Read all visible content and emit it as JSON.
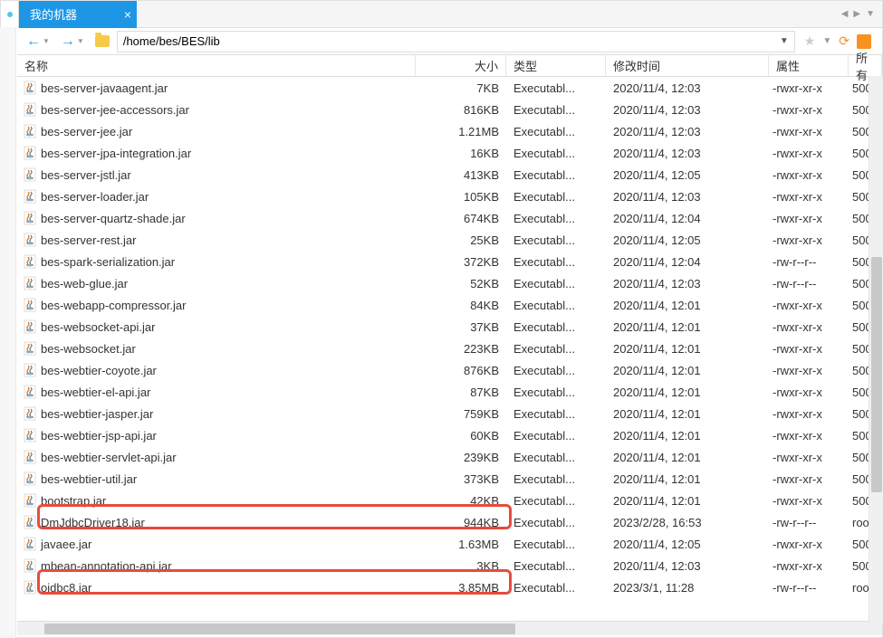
{
  "tab": {
    "title": "我的机器"
  },
  "path": "/home/bes/BES/lib",
  "headers": {
    "name": "名称",
    "size": "大小",
    "type": "类型",
    "date": "修改时间",
    "attr": "属性",
    "owner": "所有"
  },
  "type_label": "Executabl...",
  "files": [
    {
      "name": "bes-server-javaagent.jar",
      "size": "7KB",
      "date": "2020/11/4, 12:03",
      "attr": "-rwxr-xr-x",
      "owner": "500"
    },
    {
      "name": "bes-server-jee-accessors.jar",
      "size": "816KB",
      "date": "2020/11/4, 12:03",
      "attr": "-rwxr-xr-x",
      "owner": "500"
    },
    {
      "name": "bes-server-jee.jar",
      "size": "1.21MB",
      "date": "2020/11/4, 12:03",
      "attr": "-rwxr-xr-x",
      "owner": "500"
    },
    {
      "name": "bes-server-jpa-integration.jar",
      "size": "16KB",
      "date": "2020/11/4, 12:03",
      "attr": "-rwxr-xr-x",
      "owner": "500"
    },
    {
      "name": "bes-server-jstl.jar",
      "size": "413KB",
      "date": "2020/11/4, 12:05",
      "attr": "-rwxr-xr-x",
      "owner": "500"
    },
    {
      "name": "bes-server-loader.jar",
      "size": "105KB",
      "date": "2020/11/4, 12:03",
      "attr": "-rwxr-xr-x",
      "owner": "500"
    },
    {
      "name": "bes-server-quartz-shade.jar",
      "size": "674KB",
      "date": "2020/11/4, 12:04",
      "attr": "-rwxr-xr-x",
      "owner": "500"
    },
    {
      "name": "bes-server-rest.jar",
      "size": "25KB",
      "date": "2020/11/4, 12:05",
      "attr": "-rwxr-xr-x",
      "owner": "500"
    },
    {
      "name": "bes-spark-serialization.jar",
      "size": "372KB",
      "date": "2020/11/4, 12:04",
      "attr": "-rw-r--r--",
      "owner": "500"
    },
    {
      "name": "bes-web-glue.jar",
      "size": "52KB",
      "date": "2020/11/4, 12:03",
      "attr": "-rw-r--r--",
      "owner": "500"
    },
    {
      "name": "bes-webapp-compressor.jar",
      "size": "84KB",
      "date": "2020/11/4, 12:01",
      "attr": "-rwxr-xr-x",
      "owner": "500"
    },
    {
      "name": "bes-websocket-api.jar",
      "size": "37KB",
      "date": "2020/11/4, 12:01",
      "attr": "-rwxr-xr-x",
      "owner": "500"
    },
    {
      "name": "bes-websocket.jar",
      "size": "223KB",
      "date": "2020/11/4, 12:01",
      "attr": "-rwxr-xr-x",
      "owner": "500"
    },
    {
      "name": "bes-webtier-coyote.jar",
      "size": "876KB",
      "date": "2020/11/4, 12:01",
      "attr": "-rwxr-xr-x",
      "owner": "500"
    },
    {
      "name": "bes-webtier-el-api.jar",
      "size": "87KB",
      "date": "2020/11/4, 12:01",
      "attr": "-rwxr-xr-x",
      "owner": "500"
    },
    {
      "name": "bes-webtier-jasper.jar",
      "size": "759KB",
      "date": "2020/11/4, 12:01",
      "attr": "-rwxr-xr-x",
      "owner": "500"
    },
    {
      "name": "bes-webtier-jsp-api.jar",
      "size": "60KB",
      "date": "2020/11/4, 12:01",
      "attr": "-rwxr-xr-x",
      "owner": "500"
    },
    {
      "name": "bes-webtier-servlet-api.jar",
      "size": "239KB",
      "date": "2020/11/4, 12:01",
      "attr": "-rwxr-xr-x",
      "owner": "500"
    },
    {
      "name": "bes-webtier-util.jar",
      "size": "373KB",
      "date": "2020/11/4, 12:01",
      "attr": "-rwxr-xr-x",
      "owner": "500"
    },
    {
      "name": "bootstrap.jar",
      "size": "42KB",
      "date": "2020/11/4, 12:01",
      "attr": "-rwxr-xr-x",
      "owner": "500"
    },
    {
      "name": "DmJdbcDriver18.jar",
      "size": "944KB",
      "date": "2023/2/28, 16:53",
      "attr": "-rw-r--r--",
      "owner": "roo"
    },
    {
      "name": "javaee.jar",
      "size": "1.63MB",
      "date": "2020/11/4, 12:05",
      "attr": "-rwxr-xr-x",
      "owner": "500"
    },
    {
      "name": "mbean-annotation-api.jar",
      "size": "3KB",
      "date": "2020/11/4, 12:03",
      "attr": "-rwxr-xr-x",
      "owner": "500"
    },
    {
      "name": "ojdbc8.jar",
      "size": "3.85MB",
      "date": "2023/3/1, 11:28",
      "attr": "-rw-r--r--",
      "owner": "roo"
    }
  ]
}
